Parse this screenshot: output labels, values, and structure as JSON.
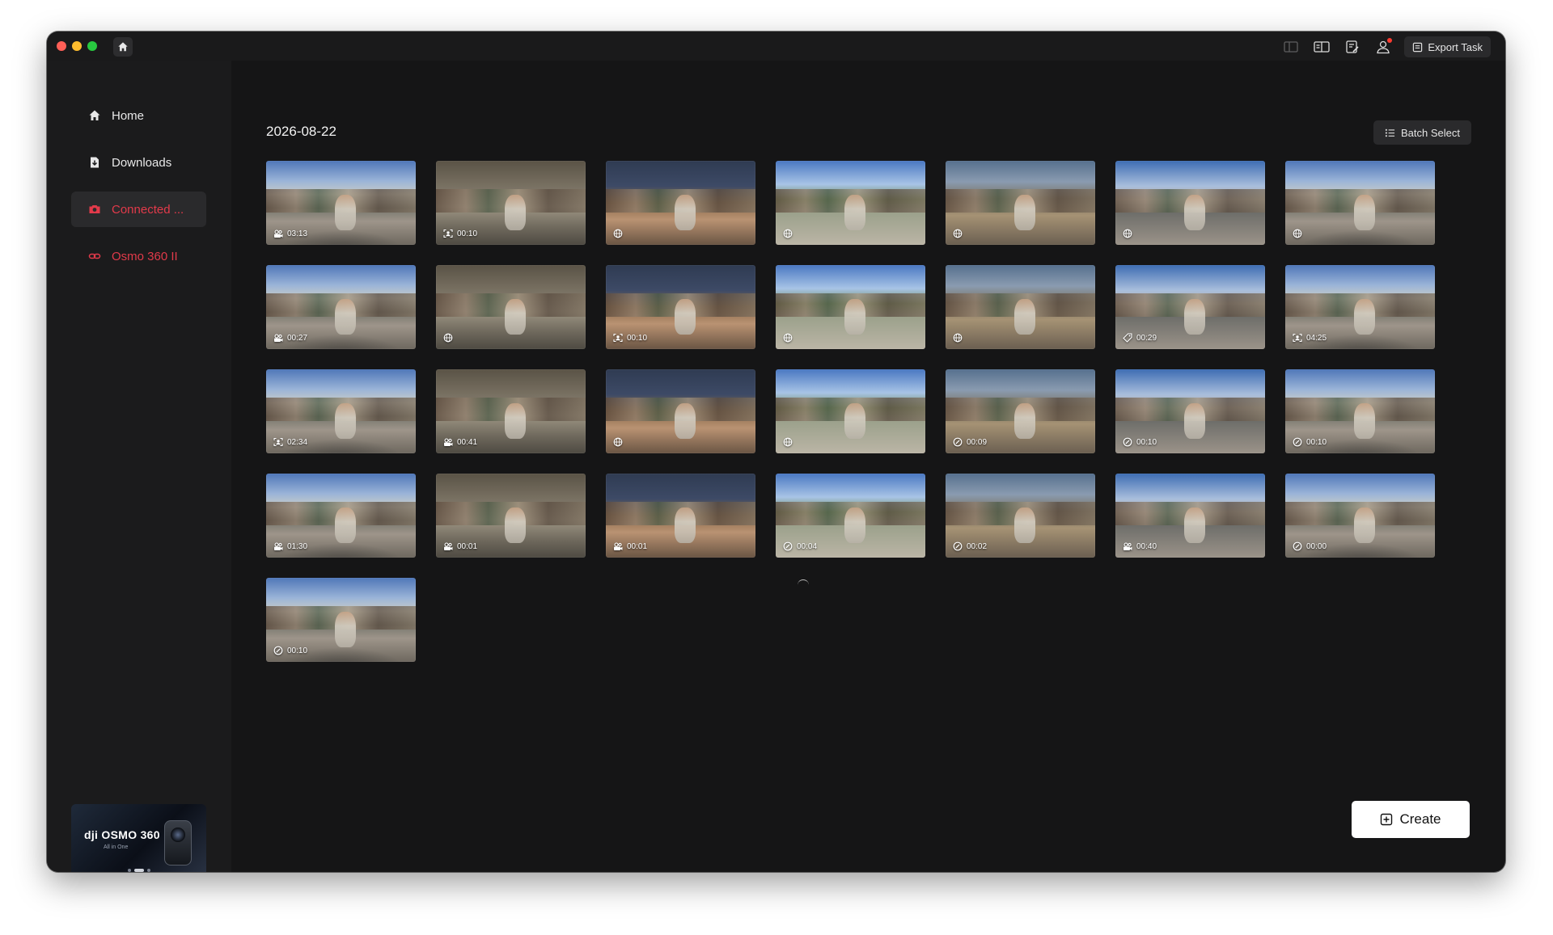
{
  "window": {
    "title_icon": "home-icon",
    "toolbar": {
      "export_task_label": "Export Task",
      "icons": [
        "sidebar-toggle-icon",
        "split-view-icon",
        "edit-note-icon",
        "account-icon"
      ]
    }
  },
  "sidebar": {
    "items": [
      {
        "label": "Home",
        "icon": "home-icon"
      },
      {
        "label": "Downloads",
        "icon": "download-icon"
      },
      {
        "label": "Connected ...",
        "icon": "camera-icon"
      },
      {
        "label": "Osmo 360 II",
        "icon": "link-icon"
      }
    ],
    "promo": {
      "brand": "dji OSMO 360",
      "subtitle": "All in One"
    }
  },
  "main": {
    "date": "2026-08-22",
    "batch_select_label": "Batch Select",
    "create_label": "Create",
    "media": [
      {
        "type": "video",
        "duration": "03:13"
      },
      {
        "type": "selfie",
        "duration": "00:10"
      },
      {
        "type": "photo360",
        "duration": ""
      },
      {
        "type": "photo360",
        "duration": ""
      },
      {
        "type": "photo360",
        "duration": ""
      },
      {
        "type": "photo360",
        "duration": ""
      },
      {
        "type": "photo360",
        "duration": ""
      },
      {
        "type": "video",
        "duration": "00:27"
      },
      {
        "type": "photo360",
        "duration": ""
      },
      {
        "type": "selfie",
        "duration": "00:10"
      },
      {
        "type": "photo360",
        "duration": ""
      },
      {
        "type": "photo360",
        "duration": ""
      },
      {
        "type": "tag",
        "duration": "00:29"
      },
      {
        "type": "selfie",
        "duration": "04:25"
      },
      {
        "type": "selfie",
        "duration": "02:34"
      },
      {
        "type": "video",
        "duration": "00:41"
      },
      {
        "type": "photo360",
        "duration": ""
      },
      {
        "type": "photo360",
        "duration": ""
      },
      {
        "type": "timelapse",
        "duration": "00:09"
      },
      {
        "type": "timelapse",
        "duration": "00:10"
      },
      {
        "type": "timelapse",
        "duration": "00:10"
      },
      {
        "type": "video",
        "duration": "01:30"
      },
      {
        "type": "video",
        "duration": "00:01"
      },
      {
        "type": "video",
        "duration": "00:01"
      },
      {
        "type": "timelapse",
        "duration": "00:04"
      },
      {
        "type": "timelapse",
        "duration": "00:02"
      },
      {
        "type": "video",
        "duration": "00:40"
      },
      {
        "type": "timelapse",
        "duration": "00:00"
      },
      {
        "type": "timelapse",
        "duration": "00:10"
      }
    ]
  }
}
